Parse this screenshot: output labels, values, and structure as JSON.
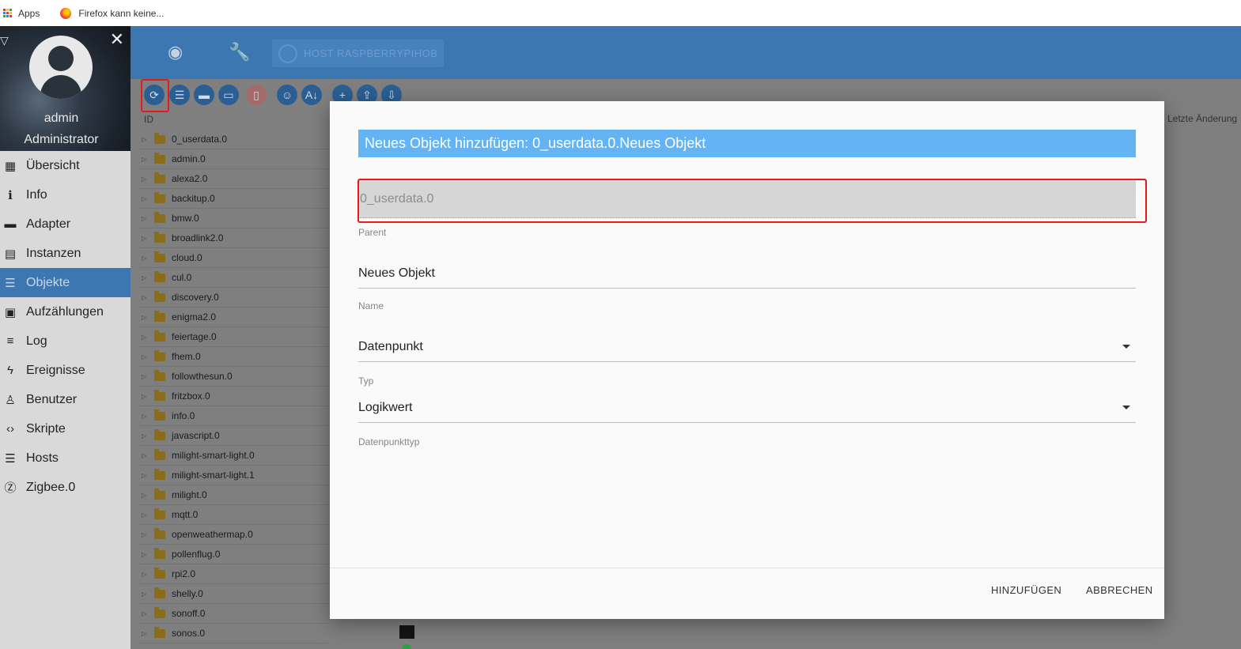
{
  "bookmarks": {
    "apps_label": "Apps",
    "firefox_label": "Firefox kann keine..."
  },
  "profile": {
    "name": "admin",
    "role": "Administrator"
  },
  "nav": [
    {
      "label": "Übersicht",
      "icon": "grid-icon",
      "glyph": "▦",
      "active": false
    },
    {
      "label": "Info",
      "icon": "info-icon",
      "glyph": "ℹ",
      "active": false
    },
    {
      "label": "Adapter",
      "icon": "store-icon",
      "glyph": "▬",
      "active": false
    },
    {
      "label": "Instanzen",
      "icon": "instances-icon",
      "glyph": "▤",
      "active": false
    },
    {
      "label": "Objekte",
      "icon": "list-icon",
      "glyph": "☰",
      "active": true
    },
    {
      "label": "Aufzählungen",
      "icon": "enum-icon",
      "glyph": "▣",
      "active": false
    },
    {
      "label": "Log",
      "icon": "log-icon",
      "glyph": "≡",
      "active": false
    },
    {
      "label": "Ereignisse",
      "icon": "lightning-icon",
      "glyph": "ϟ",
      "active": false
    },
    {
      "label": "Benutzer",
      "icon": "user-icon",
      "glyph": "♙",
      "active": false
    },
    {
      "label": "Skripte",
      "icon": "code-icon",
      "glyph": "‹›",
      "active": false
    },
    {
      "label": "Hosts",
      "icon": "server-icon",
      "glyph": "☰",
      "active": false
    },
    {
      "label": "Zigbee.0",
      "icon": "zigbee-icon",
      "glyph": "Ⓩ",
      "active": false
    }
  ],
  "header": {
    "host_label": "HOST RASPBERRYPIHOB"
  },
  "table": {
    "col_id": "ID",
    "col_last_changed": "Letzte Änderung",
    "rows": [
      "0_userdata.0",
      "admin.0",
      "alexa2.0",
      "backitup.0",
      "bmw.0",
      "broadlink2.0",
      "cloud.0",
      "cul.0",
      "discovery.0",
      "enigma2.0",
      "feiertage.0",
      "fhem.0",
      "followthesun.0",
      "fritzbox.0",
      "info.0",
      "javascript.0",
      "milight-smart-light.0",
      "milight-smart-light.1",
      "milight.0",
      "mqtt.0",
      "openweathermap.0",
      "pollenflug.0",
      "rpi2.0",
      "shelly.0",
      "sonoff.0",
      "sonos.0"
    ]
  },
  "dialog": {
    "title": "Neues Objekt hinzufügen: 0_userdata.0.Neues Objekt",
    "parent_value": "0_userdata.0",
    "parent_label": "Parent",
    "name_value": "Neues Objekt",
    "name_label": "Name",
    "type_value": "Datenpunkt",
    "type_label": "Typ",
    "datatype_value": "Logikwert",
    "datatype_label": "Datenpunkttyp",
    "add_button": "HINZUFÜGEN",
    "cancel_button": "ABBRECHEN"
  },
  "colors": {
    "header_blue": "#3d77b2",
    "dialog_title_blue": "#64b4f5",
    "highlight_red": "#e41b1b"
  }
}
